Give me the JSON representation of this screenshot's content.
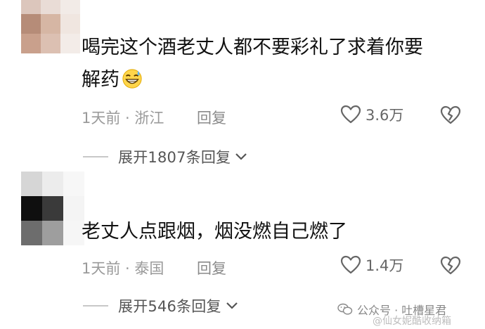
{
  "colors": {
    "text": "#111111",
    "meta": "#9a9a9a",
    "icon": "#666666",
    "divider": "#c8c8c8"
  },
  "comments": [
    {
      "text_line1": "喝完这个酒老丈人都不要彩礼了求着你要",
      "text_line2": "解药",
      "emoji": "grinning-sweat-emoji",
      "meta": "1天前 · 浙江",
      "reply": "回复",
      "likes": "3.6万",
      "expand": "展开1807条回复",
      "avatar_colors": [
        "#dcc6bc",
        "#e9dcd6",
        "#f2ebe7",
        "#b68c78",
        "#d6b6a4",
        "#f0e6e0",
        "#c9a08c",
        "#dcc0b2",
        "#f3ece8"
      ]
    },
    {
      "text": "老丈人点跟烟，烟没燃自己燃了",
      "meta": "1天前 · 泰国",
      "reply": "回复",
      "likes": "1.4万",
      "expand": "展开546条回复",
      "avatar_colors": [
        "#d6d6d6",
        "#ececec",
        "#f7f7f7",
        "#0f0f0f",
        "#3a3a3a",
        "#f4f4f4",
        "#6d6d6d",
        "#9e9e9e",
        "#f6f6f6"
      ]
    }
  ],
  "watermark": {
    "text": "公众号 · 吐槽星君",
    "sub": "@仙女妮酷收纳箱",
    "icon": "wechat-icon"
  }
}
